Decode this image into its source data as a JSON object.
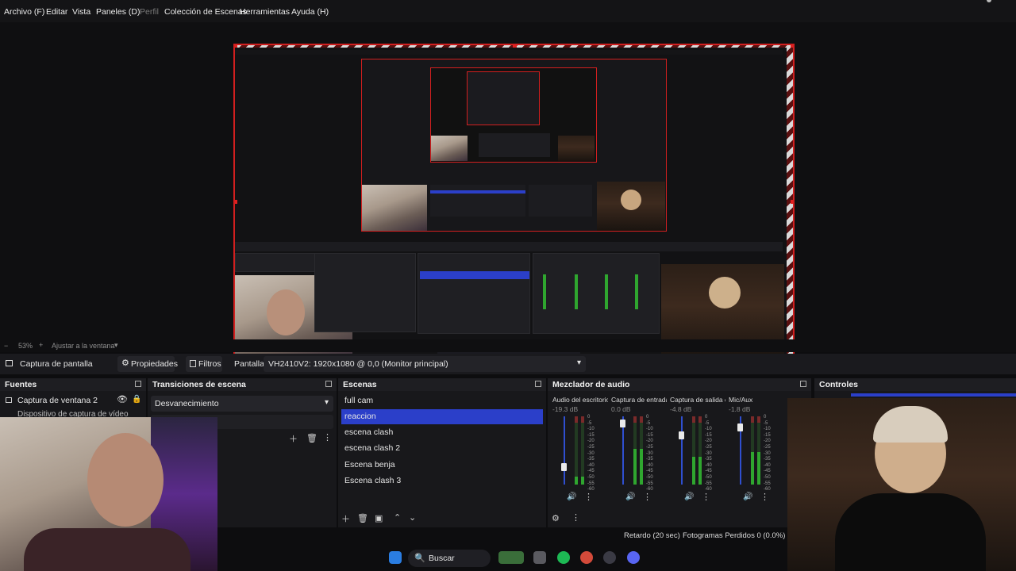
{
  "menu": {
    "items": [
      "Archivo (F)",
      "Editar",
      "Vista",
      "Paneles (D)",
      "Perfil",
      "Colección de Escenas",
      "Herramientas",
      "Ayuda (H)"
    ],
    "dim_index": 4
  },
  "zoom": {
    "level": "53%",
    "fit_label": "Ajustar a la ventana"
  },
  "source_bar": {
    "source_name": "Captura de pantalla",
    "properties_label": "Propiedades",
    "filters_label": "Filtros",
    "display_label": "Pantalla",
    "display_value": "VH2410V2: 1920x1080 @ 0,0 (Monitor principal)"
  },
  "docks": {
    "sources": {
      "title": "Fuentes",
      "items": [
        "Captura de ventana 2",
        "Dispositivo de captura de vídeo"
      ]
    },
    "transitions": {
      "title": "Transiciones de escena",
      "selected": "Desvanecimiento"
    },
    "scenes": {
      "title": "Escenas",
      "items": [
        "full cam",
        "reaccion",
        "escena clash",
        "escena clash 2",
        "Escena benja",
        "Escena clash 3"
      ],
      "selected_index": 1
    },
    "mixer": {
      "title": "Mezclador de audio",
      "channels": [
        {
          "name": "Audio del escritorio",
          "db": "-19.3 dB",
          "level": 0.22
        },
        {
          "name": "Captura de entrada",
          "db": "0.0 dB",
          "level": 0.95
        },
        {
          "name": "Captura de salida c",
          "db": "-4.8 dB",
          "level": 0.75
        },
        {
          "name": "Mic/Aux",
          "db": "-1.8 dB",
          "level": 0.88
        }
      ]
    },
    "controls": {
      "title": "Controles"
    }
  },
  "status": {
    "delay": "Retardo (20 sec)",
    "dropped": "Fotogramas Perdidos 0 (0.0%)"
  },
  "taskbar": {
    "search_label": "Buscar"
  },
  "colors": {
    "selection": "#2b3fc9",
    "preview_border": "#d21f1f",
    "meter_green": "#2fa62f"
  }
}
